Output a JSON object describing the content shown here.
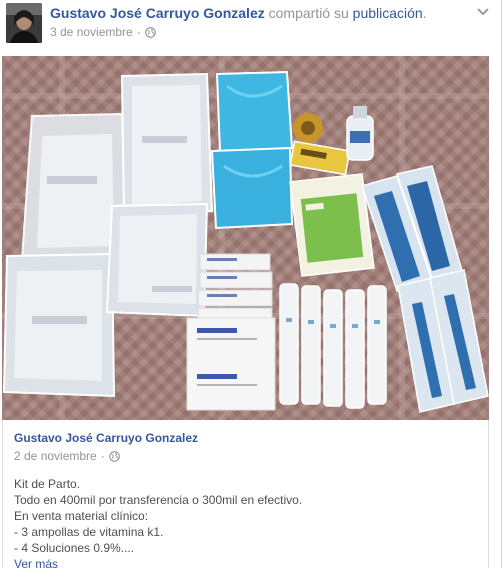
{
  "header": {
    "author": "Gustavo José Carruyo Gonzalez",
    "action": "compartió su",
    "object": "publicación",
    "period": ".",
    "date": "3 de noviembre",
    "separator": "·",
    "privacy_icon": "globe-icon",
    "more_icon": "chevron-down-icon"
  },
  "photo": {
    "description_icon": "photo"
  },
  "shared_post": {
    "author": "Gustavo José Carruyo Gonzalez",
    "date": "2 de noviembre",
    "separator": "·",
    "privacy_icon": "globe-icon",
    "lines": [
      "Kit de Parto.",
      "Todo en 400mil por transferencia o 300mil en efectivo.",
      "En venta material clínico:",
      "- 3 ampollas de vitamina k1.",
      "- 4 Soluciones 0.9%...."
    ],
    "see_more": "Ver más"
  }
}
